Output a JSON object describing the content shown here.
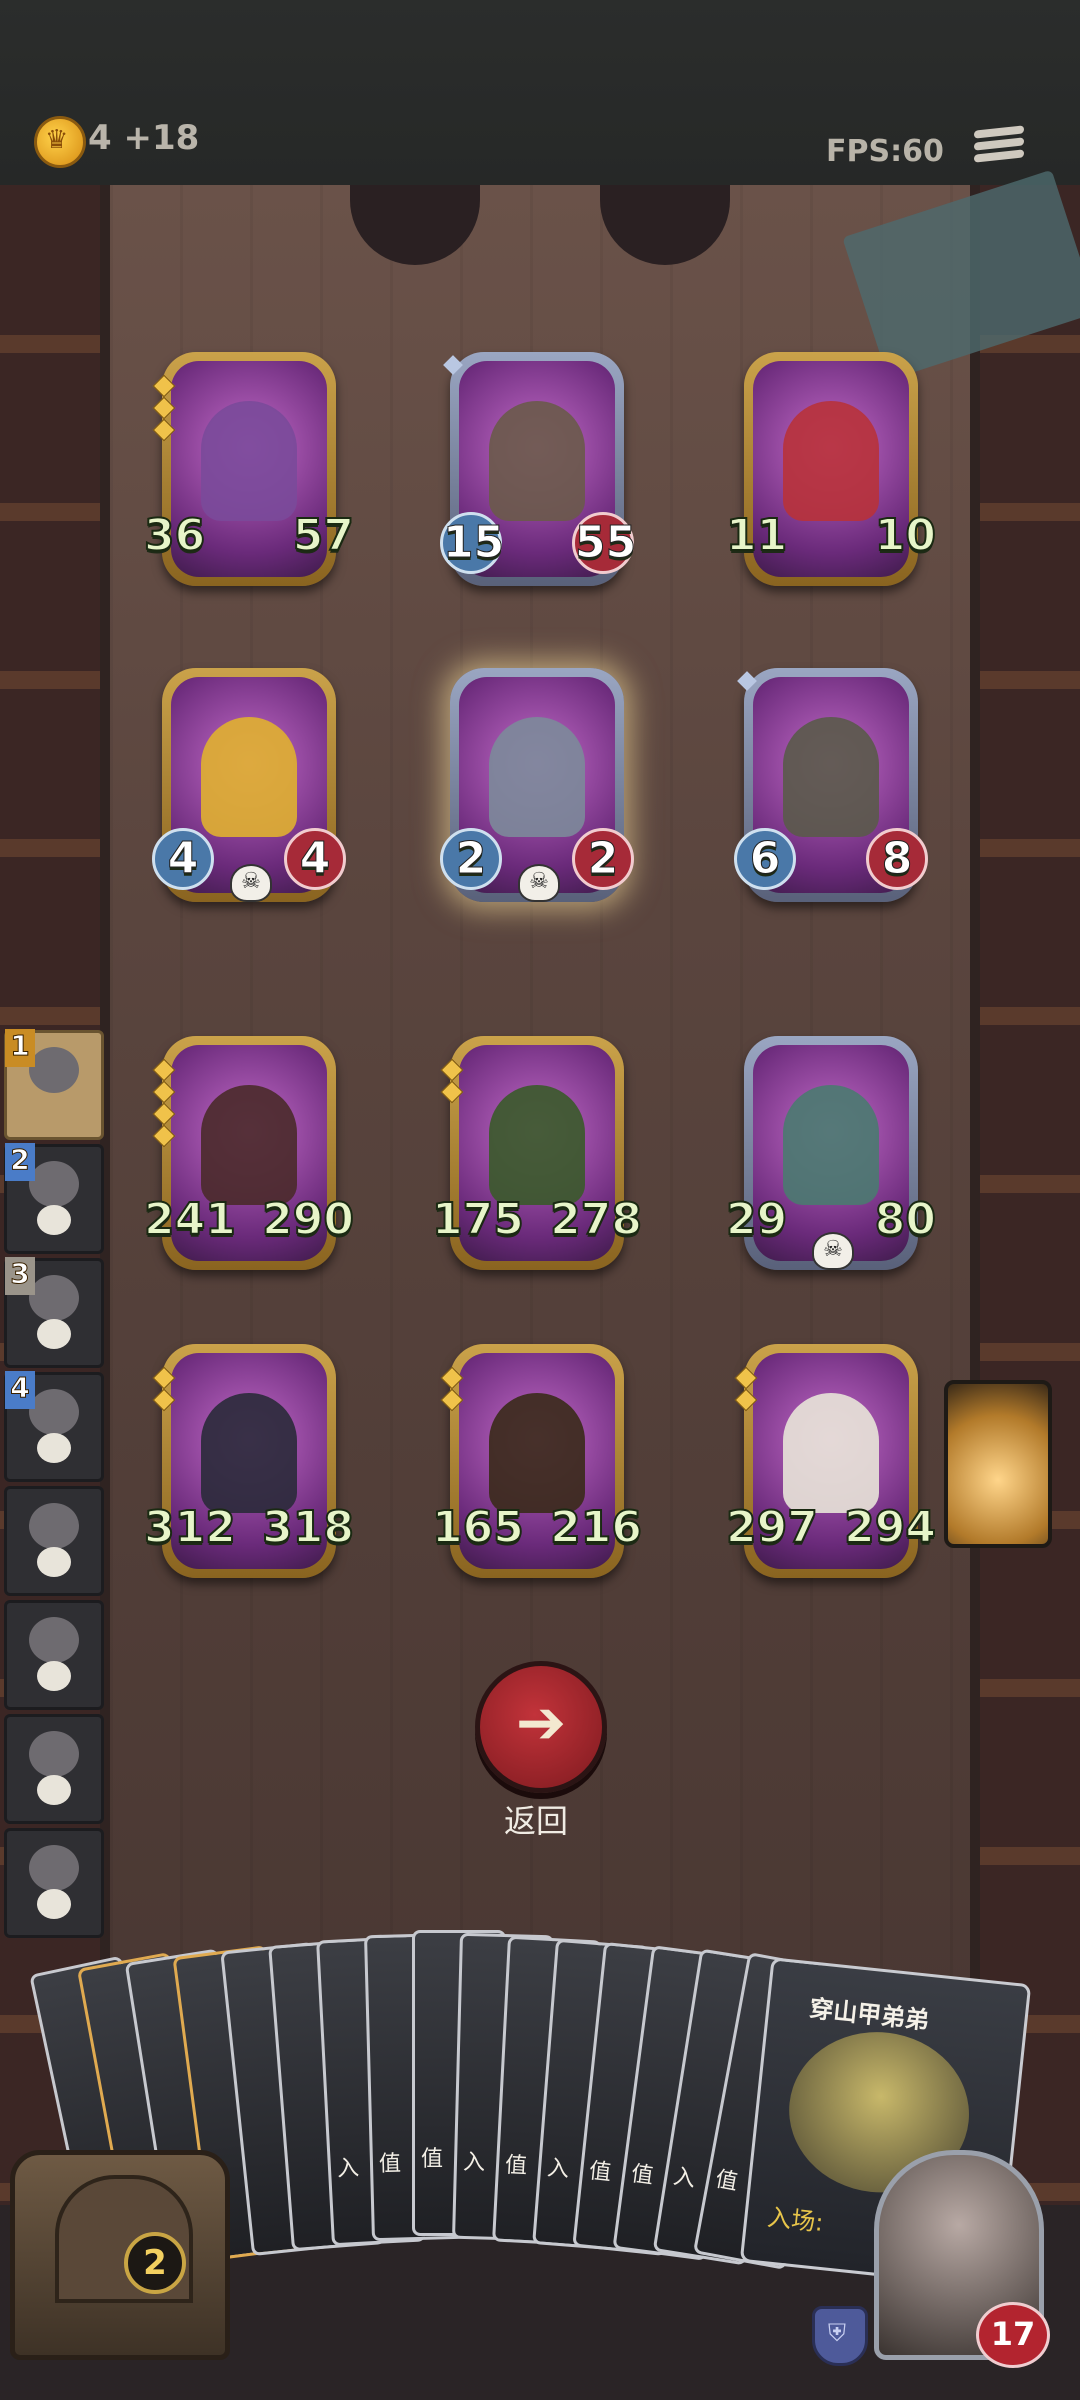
{
  "top_bar": {
    "gold_amount": "4",
    "gold_income": "+18",
    "fps": "FPS:60"
  },
  "board": {
    "units": [
      {
        "id": "octopus-pirate",
        "atk": "36",
        "hp": "57",
        "frame": "gold",
        "stars": 3,
        "color": "#7a4a9a"
      },
      {
        "id": "ghost-ship",
        "atk": "15",
        "hp": "55",
        "frame": "silver",
        "stars": 1,
        "color": "#6a5a4a",
        "circle_stats": true
      },
      {
        "id": "jester-clown",
        "atk": "11",
        "hp": "10",
        "frame": "gold",
        "stars": 0,
        "color": "#b8323a"
      },
      {
        "id": "pinocchio",
        "atk": "4",
        "hp": "4",
        "frame": "gold",
        "stars": 0,
        "color": "#e0b030",
        "circle_stats": true,
        "skull": true
      },
      {
        "id": "robot-hat",
        "atk": "2",
        "hp": "2",
        "frame": "silver",
        "stars": 0,
        "color": "#7c8a9a",
        "circle_stats": true,
        "skull": true,
        "highlight": true
      },
      {
        "id": "scarecrow",
        "atk": "6",
        "hp": "8",
        "frame": "silver",
        "stars": 1,
        "color": "#5a5a4a",
        "circle_stats": true
      },
      {
        "id": "boar",
        "atk": "241",
        "hp": "290",
        "frame": "gold",
        "stars": 4,
        "color": "#4a2a2a"
      },
      {
        "id": "witch-doctor",
        "atk": "175",
        "hp": "278",
        "frame": "gold",
        "stars": 2,
        "color": "#3a5a2a"
      },
      {
        "id": "armored-knight",
        "atk": "29",
        "hp": "80",
        "frame": "silver",
        "stars": 0,
        "color": "#4a7a70",
        "skull": true
      },
      {
        "id": "black-panther",
        "atk": "312",
        "hp": "318",
        "frame": "gold",
        "stars": 2,
        "color": "#2a2a3a"
      },
      {
        "id": "treant",
        "atk": "165",
        "hp": "216",
        "frame": "gold",
        "stars": 2,
        "color": "#3a2a1a"
      },
      {
        "id": "cow-dog",
        "atk": "297",
        "hp": "294",
        "frame": "gold",
        "stars": 2,
        "color": "#e8e4d8"
      }
    ]
  },
  "back_button": {
    "label": "返回",
    "icon": "arrow-left-icon"
  },
  "queue": {
    "slots": [
      {
        "number": "1",
        "active": true
      },
      {
        "number": "2"
      },
      {
        "number": "3"
      },
      {
        "number": "4"
      },
      {
        "number": ""
      },
      {
        "number": ""
      },
      {
        "number": ""
      },
      {
        "number": ""
      }
    ]
  },
  "hand": {
    "featured_card_title": "穿山甲弟弟",
    "featured_card_entry": "入场:",
    "card_count": 16,
    "visible_tags": [
      "入",
      "值",
      "值",
      "入",
      "值",
      "入",
      "值",
      "值",
      "入",
      "值"
    ]
  },
  "chest": {
    "count": "2"
  },
  "player": {
    "hp": "17",
    "shield_icon": "shield-icon"
  },
  "colors": {
    "gold_frame": "#caa24a",
    "silver_frame": "#9aa6c2",
    "card_bg": "#c26ac8",
    "back_button": "#c2333a",
    "stat_text": "#e7f5c9"
  }
}
